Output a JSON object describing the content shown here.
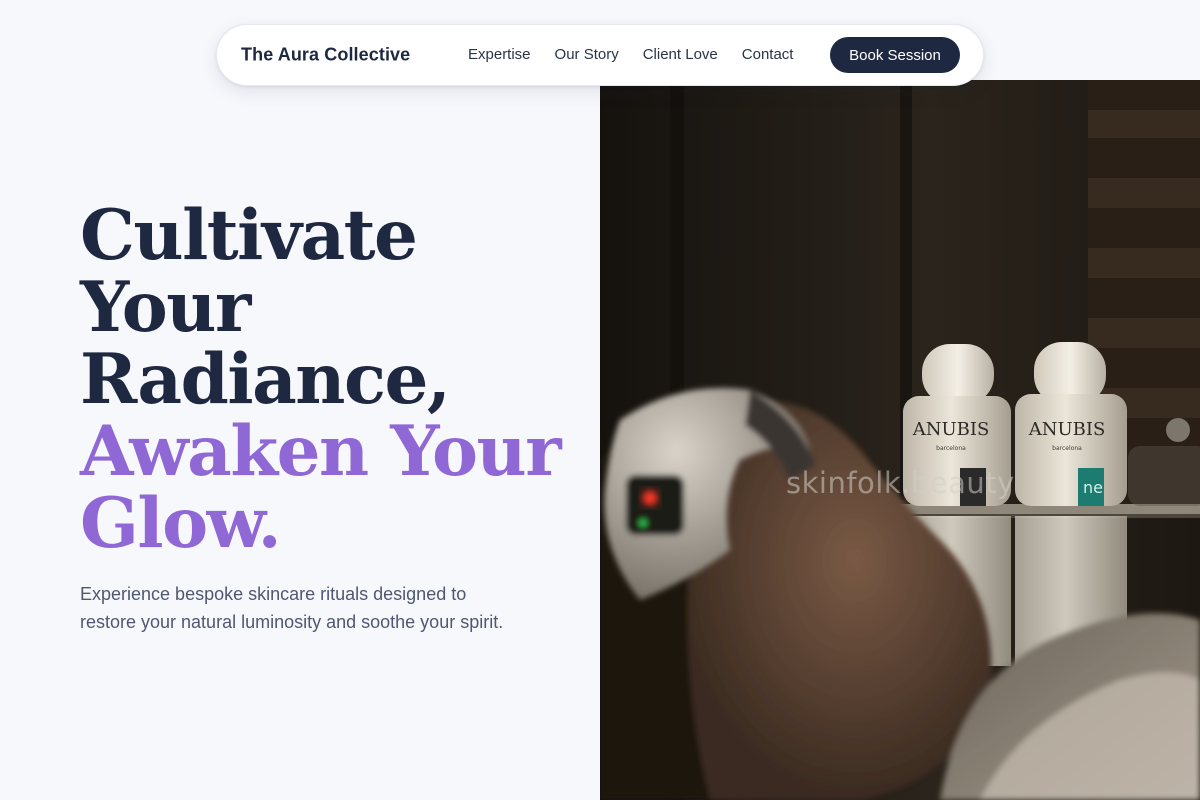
{
  "nav": {
    "brand": "The Aura Collective",
    "links": [
      "Expertise",
      "Our Story",
      "Client Love",
      "Contact"
    ],
    "cta": "Book Session"
  },
  "hero": {
    "title_lines": [
      "Cultivate",
      "Your",
      "Radiance,"
    ],
    "accent_lines": [
      "Awaken Your",
      "Glow."
    ],
    "subtitle": "Experience bespoke skincare rituals designed to restore your natural luminosity and soothe your spirit.",
    "image": {
      "watermark": "skinfolk.beauty",
      "bottle_brand": "ANUBIS",
      "bottle_sub": "barcelona"
    }
  },
  "colors": {
    "background": "#f7f8fc",
    "navy": "#1e2840",
    "accent_purple": "#9068d6",
    "body_text": "#4f5870"
  }
}
